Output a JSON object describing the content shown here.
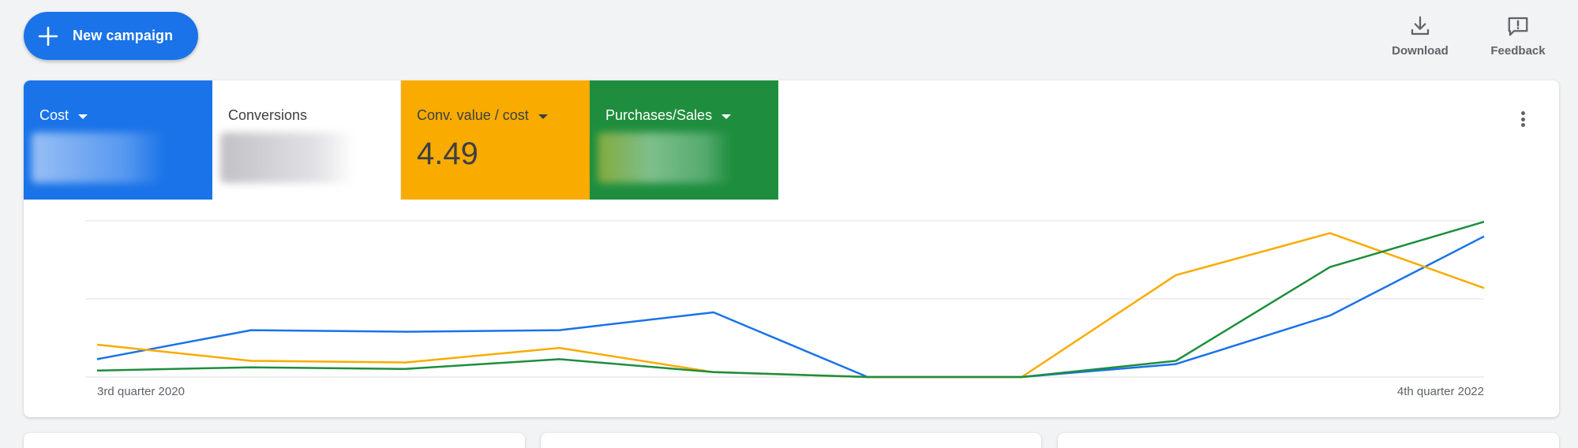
{
  "toolbar": {
    "new_campaign_label": "New campaign",
    "download_label": "Download",
    "feedback_label": "Feedback"
  },
  "metrics": [
    {
      "label": "Cost",
      "has_dropdown": true,
      "value": "",
      "value_obscured": true,
      "color": "#1a73e8"
    },
    {
      "label": "Conversions",
      "has_dropdown": false,
      "value": "",
      "value_obscured": true,
      "color": "#ffffff"
    },
    {
      "label": "Conv. value / cost",
      "has_dropdown": true,
      "value": "4.49",
      "value_obscured": false,
      "color": "#f9ab00"
    },
    {
      "label": "Purchases/Sales",
      "has_dropdown": true,
      "value": "",
      "value_obscured": true,
      "color": "#1e8e3e"
    }
  ],
  "chart_data": {
    "type": "line",
    "x": [
      "3rd quarter 2020",
      "",
      "",
      "",
      "",
      "",
      "",
      "",
      "",
      "4th quarter 2022"
    ],
    "x_tick_labels": {
      "first": "3rd quarter 2020",
      "last": "4th quarter 2022"
    },
    "ylim": [
      0,
      1
    ],
    "y_normalized": true,
    "grid": true,
    "series": [
      {
        "metric": "Cost",
        "color": "#1a73e8",
        "values": [
          0.11,
          0.29,
          0.28,
          0.29,
          0.4,
          0.0,
          0.0,
          0.08,
          0.38,
          0.87
        ]
      },
      {
        "metric": "Conv. value / cost",
        "color": "#f9ab00",
        "values": [
          0.2,
          0.1,
          0.09,
          0.18,
          0.03,
          0.0,
          0.0,
          0.63,
          0.89,
          0.55
        ]
      },
      {
        "metric": "Purchases/Sales",
        "color": "#1e8e3e",
        "values": [
          0.04,
          0.06,
          0.05,
          0.11,
          0.03,
          0.0,
          0.0,
          0.1,
          0.68,
          0.96
        ]
      }
    ]
  },
  "colors": {
    "accent": "#1a73e8",
    "background": "#f1f3f4",
    "card": "#ffffff"
  },
  "icons": {
    "new_campaign": "plus-icon",
    "download": "download-icon",
    "feedback": "feedback-icon",
    "more": "more-vert-icon"
  }
}
